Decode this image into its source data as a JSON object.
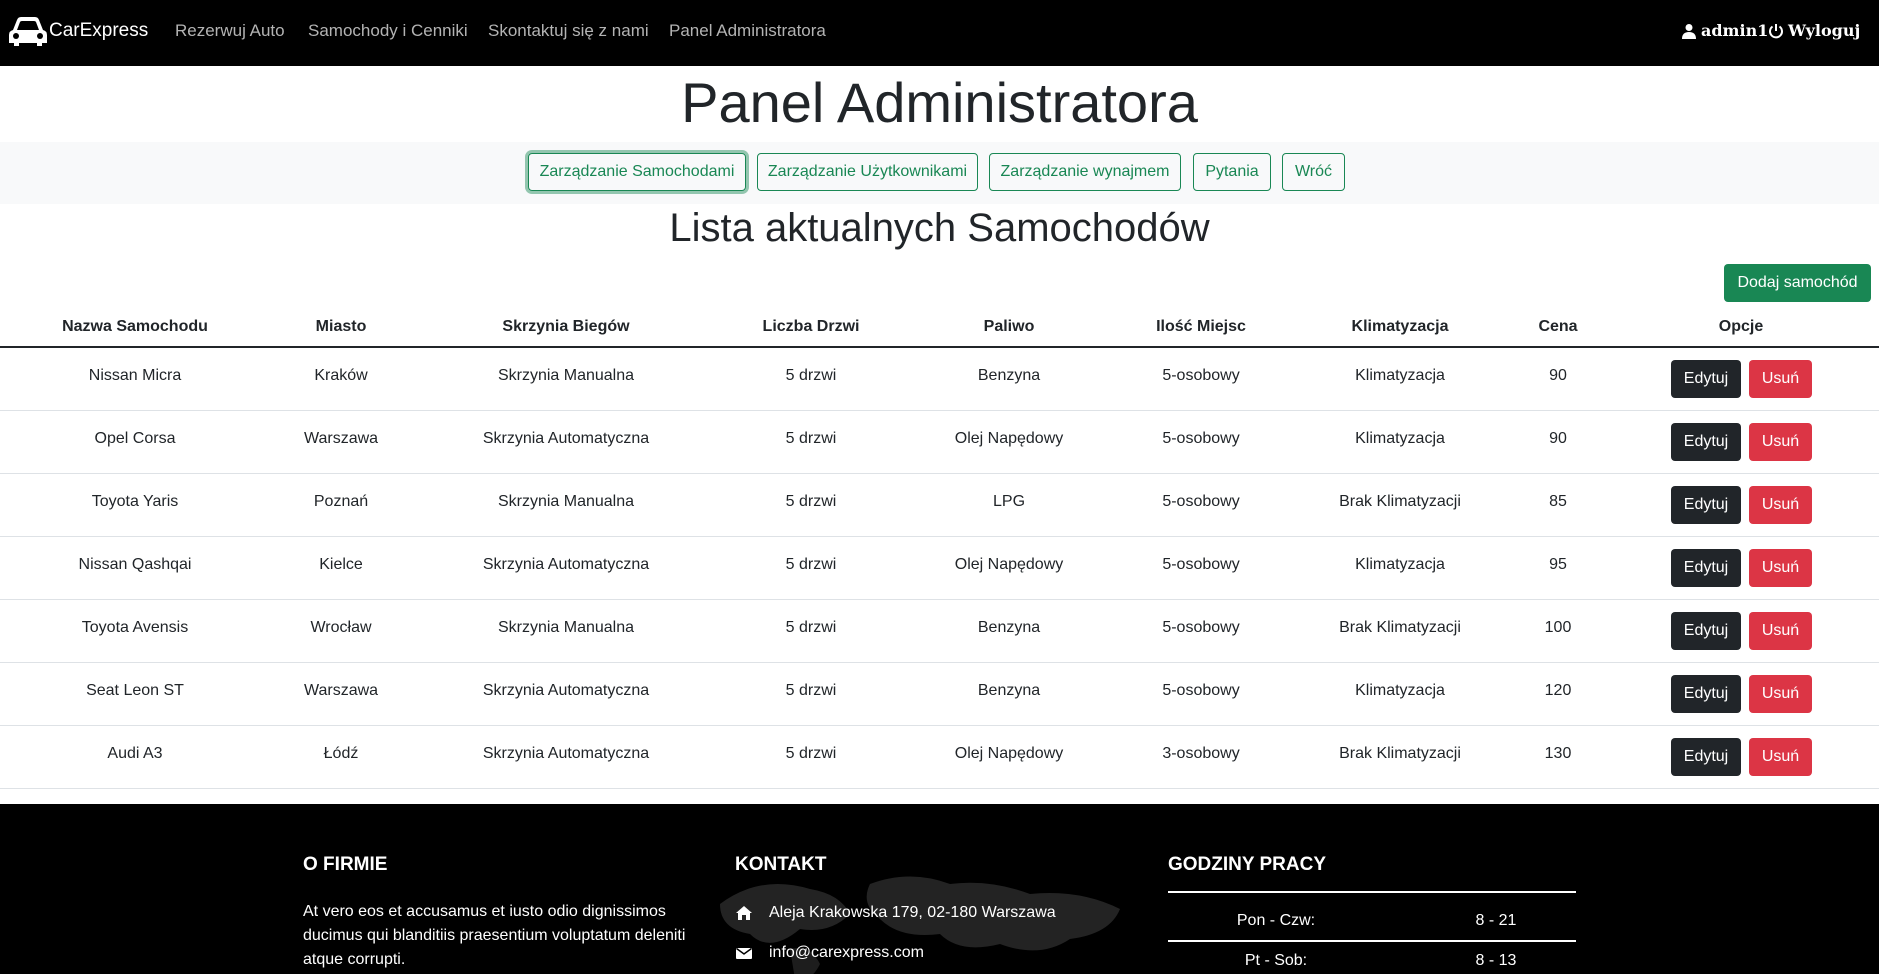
{
  "navbar": {
    "brand": "CarExpress",
    "links": [
      "Rezerwuj Auto",
      "Samochody i Cenniki",
      "Skontaktuj się z nami",
      "Panel Administratora"
    ],
    "user": "admin1",
    "logout": "Wyloguj"
  },
  "page": {
    "title": "Panel Administratora",
    "subtitle": "Lista aktualnych Samochodów"
  },
  "admin_tabs": [
    "Zarządzanie Samochodami",
    "Zarządzanie Użytkownikami",
    "Zarządzanie wynajmem",
    "Pytania",
    "Wróć"
  ],
  "active_tab": "Zarządzanie Samochodami",
  "add_button": "Dodaj samochód",
  "table": {
    "headers": [
      "Nazwa Samochodu",
      "Miasto",
      "Skrzynia Biegów",
      "Liczba Drzwi",
      "Paliwo",
      "Ilość Miejsc",
      "Klimatyzacja",
      "Cena",
      "Opcje"
    ],
    "rows": [
      [
        "Nissan Micra",
        "Kraków",
        "Skrzynia Manualna",
        "5 drzwi",
        "Benzyna",
        "5-osobowy",
        "Klimatyzacja",
        "90"
      ],
      [
        "Opel Corsa",
        "Warszawa",
        "Skrzynia Automatyczna",
        "5 drzwi",
        "Olej Napędowy",
        "5-osobowy",
        "Klimatyzacja",
        "90"
      ],
      [
        "Toyota Yaris",
        "Poznań",
        "Skrzynia Manualna",
        "5 drzwi",
        "LPG",
        "5-osobowy",
        "Brak Klimatyzacji",
        "85"
      ],
      [
        "Nissan Qashqai",
        "Kielce",
        "Skrzynia Automatyczna",
        "5 drzwi",
        "Olej Napędowy",
        "5-osobowy",
        "Klimatyzacja",
        "95"
      ],
      [
        "Toyota Avensis",
        "Wrocław",
        "Skrzynia Manualna",
        "5 drzwi",
        "Benzyna",
        "5-osobowy",
        "Brak Klimatyzacji",
        "100"
      ],
      [
        "Seat Leon ST",
        "Warszawa",
        "Skrzynia Automatyczna",
        "5 drzwi",
        "Benzyna",
        "5-osobowy",
        "Klimatyzacja",
        "120"
      ],
      [
        "Audi A3",
        "Łódź",
        "Skrzynia Automatyczna",
        "5 drzwi",
        "Olej Napędowy",
        "3-osobowy",
        "Brak Klimatyzacji",
        "130"
      ]
    ],
    "edit_label": "Edytuj",
    "delete_label": "Usuń"
  },
  "footer": {
    "about_title": "O FIRMIE",
    "about_text": "At vero eos et accusamus et iusto odio dignissimos ducimus qui blanditiis praesentium voluptatum deleniti atque corrupti.",
    "contact_title": "KONTAKT",
    "address": "Aleja Krakowska 179, 02-180 Warszawa",
    "email": "info@carexpress.com",
    "hours_title": "GODZINY PRACY",
    "hours": [
      {
        "days": "Pon - Czw:",
        "time": "8 - 21"
      },
      {
        "days": "Pt - Sob:",
        "time": "8 - 13"
      }
    ]
  },
  "colors": {
    "navbar_bg": "#000000",
    "success": "#198754",
    "danger": "#dc3545",
    "dark": "#212529"
  }
}
